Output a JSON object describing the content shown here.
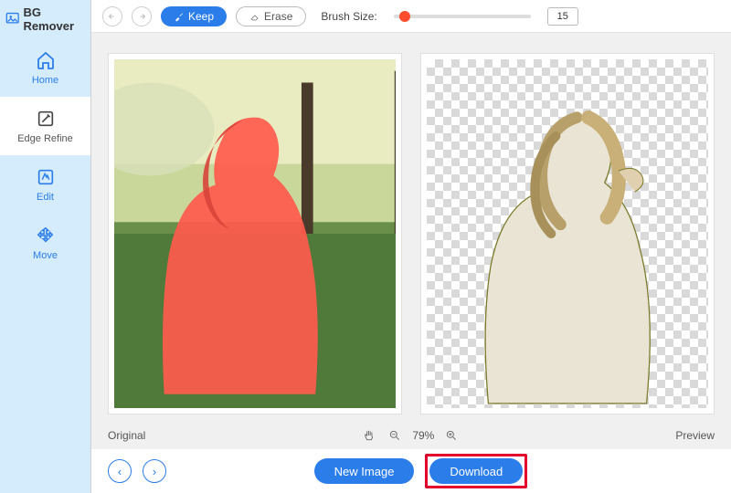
{
  "brand": "BG Remover",
  "sidebar": {
    "items": [
      {
        "label": "Home"
      },
      {
        "label": "Edge Refine"
      },
      {
        "label": "Edit"
      },
      {
        "label": "Move"
      }
    ]
  },
  "toolbar": {
    "keep": "Keep",
    "erase": "Erase",
    "brush_label": "Brush Size:",
    "brush_size": "15"
  },
  "status": {
    "original": "Original",
    "zoom": "79%",
    "preview": "Preview"
  },
  "bottom": {
    "new_image": "New Image",
    "download": "Download"
  },
  "colors": {
    "accent": "#2b7de9",
    "mask": "#ff5a4d",
    "highlight": "#e3002b"
  }
}
